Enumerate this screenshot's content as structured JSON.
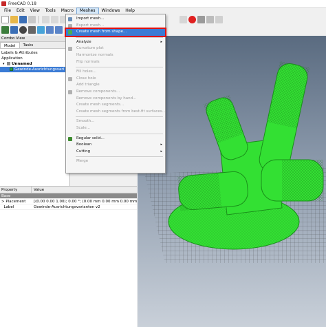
{
  "window": {
    "title": "FreeCAD 0.18"
  },
  "menubar": [
    "File",
    "Edit",
    "View",
    "Tools",
    "Macro",
    "Meshes",
    "Windows",
    "Help"
  ],
  "combo_view": {
    "header": "Combo View",
    "tabs": [
      "Model",
      "Tasks"
    ],
    "tree": {
      "section": "Labels & Attributes",
      "root": "Application",
      "document": "Unnamed",
      "object": "Gewinde-Ausrichtungsvari"
    }
  },
  "properties": {
    "col_property": "Property",
    "col_value": "Value",
    "group": "Base",
    "rows": [
      {
        "name": "Placement",
        "value": "[(0.00 0.00 1.00); 0.00 °; (0.00 mm  0.00 mm  0.00 mm)]",
        "expander": ">"
      },
      {
        "name": "Label",
        "value": "Gewinde-Ausrichtungsvarianten v2",
        "expander": ""
      }
    ]
  },
  "meshes_menu": {
    "items": [
      {
        "label": "Import mesh...",
        "disabled": false,
        "icon": "import-mesh-icon",
        "color": "#6b8fb8"
      },
      {
        "label": "Export mesh...",
        "disabled": true,
        "icon": "export-mesh-icon",
        "color": "#b0b0b0"
      },
      {
        "label": "Create mesh from shape...",
        "disabled": false,
        "highlight": true,
        "icon": "create-mesh-icon",
        "color": "#4caf50"
      },
      {
        "sep": true
      },
      {
        "label": "Analyze",
        "disabled": false,
        "submenu": true
      },
      {
        "label": "Curvature plot",
        "disabled": true,
        "icon": "curvature-icon",
        "color": "#b0b0b0"
      },
      {
        "label": "Harmonize normals",
        "disabled": true
      },
      {
        "label": "Flip normals",
        "disabled": true
      },
      {
        "sep": true
      },
      {
        "label": "Fill holes...",
        "disabled": true
      },
      {
        "label": "Close hole",
        "disabled": true,
        "icon": "close-hole-icon",
        "color": "#b0b0b0"
      },
      {
        "label": "Add triangle",
        "disabled": true
      },
      {
        "label": "Remove components...",
        "disabled": true,
        "icon": "remove-components-icon",
        "color": "#b0b0b0"
      },
      {
        "label": "Remove components by hand...",
        "disabled": true
      },
      {
        "label": "Create mesh segments...",
        "disabled": true
      },
      {
        "label": "Create mesh segments from best-fit surfaces...",
        "disabled": true
      },
      {
        "sep": true
      },
      {
        "label": "Smooth...",
        "disabled": true
      },
      {
        "label": "Scale...",
        "disabled": true
      },
      {
        "sep": true
      },
      {
        "label": "Regular solid...",
        "disabled": false,
        "icon": "regular-solid-icon",
        "color": "#3d8b2f"
      },
      {
        "label": "Boolean",
        "disabled": false,
        "submenu": true
      },
      {
        "label": "Cutting",
        "disabled": false,
        "submenu": true
      },
      {
        "sep": true
      },
      {
        "label": "Merge",
        "disabled": true
      }
    ],
    "submenu_arrow": "▸"
  },
  "icons": {
    "tree_expanded": "▾",
    "tree_collapsed": "▸"
  },
  "colors": {
    "mesh": "#33e033",
    "highlight": "#e01010",
    "selection": "#3a7bd5"
  }
}
